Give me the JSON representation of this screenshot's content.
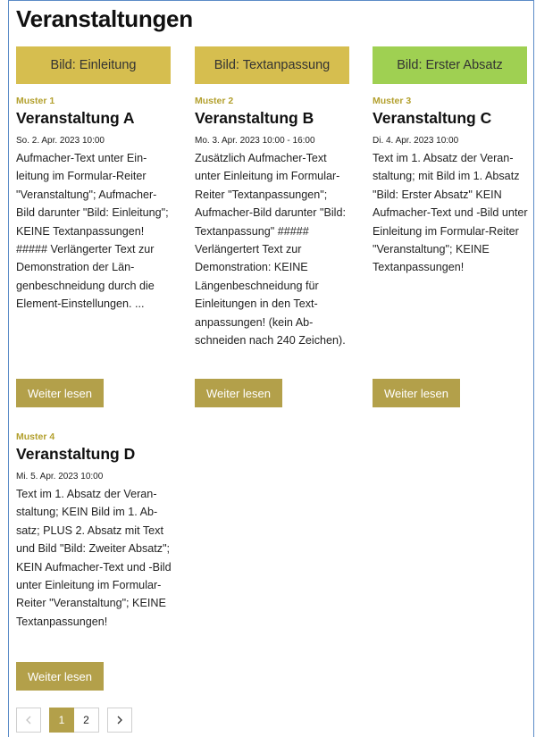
{
  "page": {
    "title": "Veranstaltungen"
  },
  "events": [
    {
      "image_label": "Bild: Einleitung",
      "pattern": "Muster 1",
      "title": "Veranstaltung A",
      "date": "So. 2. Apr. 2023 10:00",
      "text": "Aufmacher-Text unter Ein­leitung im Formular-Reiter \"Veranstaltung\"; Aufmacher-Bild darunter \"Bild: Einlei­tung\"; KEINE Textanpassun­gen! ##### Verlängerter Text zur Demonstration der Län­genbeschneidung durch die Element-Einstellungen. ...",
      "button_label": "Weiter lesen"
    },
    {
      "image_label": "Bild: Textanpassung",
      "pattern": "Muster 2",
      "title": "Veranstaltung B",
      "date": "Mo. 3. Apr. 2023 10:00 - 16:00",
      "text": "Zusätzlich Aufmacher-Text unter Einleitung im Formular-Reiter \"Textanpas­sungen\"; Aufmacher-Bild darunter \"Bild: Textanpas­sung\" ##### Verlängertert Text zur Demonstration: KEINE Längenbeschneidung für Einleitungen in den Text­anpassungen! (kein Ab­schneiden nach 240 Zei­chen).",
      "button_label": "Weiter lesen"
    },
    {
      "image_label": "Bild: Erster Absatz",
      "pattern": "Muster 3",
      "title": "Veranstaltung C",
      "date": "Di. 4. Apr. 2023 10:00",
      "text": "Text im 1. Absatz der Veran­staltung; mit Bild im 1. Ab­satz \"Bild: Erster Absatz\" KEIN Aufmacher-Text und -Bild unter Einleitung im Formular-Reiter \"Veranstal­tung\"; KEINE Textanpassun­gen!",
      "button_label": "Weiter lesen"
    },
    {
      "pattern": "Muster 4",
      "title": "Veranstaltung D",
      "date": "Mi. 5. Apr. 2023 10:00",
      "text": "Text im 1. Absatz der Veran­staltung; KEIN Bild im 1. Ab­satz; PLUS 2. Absatz mit Text und Bild \"Bild: Zweiter Ab­satz\"; KEIN Aufmacher-Text und -Bild unter Einleitung im Formular-Reiter \"Veran­staltung\"; KEINE Textanpas­sungen!",
      "button_label": "Weiter lesen"
    }
  ],
  "pagination": {
    "prev_icon": "chevron-left-icon",
    "pages": [
      "1",
      "2"
    ],
    "active_page": "1",
    "next_icon": "chevron-right-icon"
  },
  "colors": {
    "accent": "#b3a04a",
    "image_gold": "#d6be4f",
    "image_green": "#9fd052",
    "pattern_label": "#b3a02e",
    "frame_border": "#5b8bc7"
  }
}
